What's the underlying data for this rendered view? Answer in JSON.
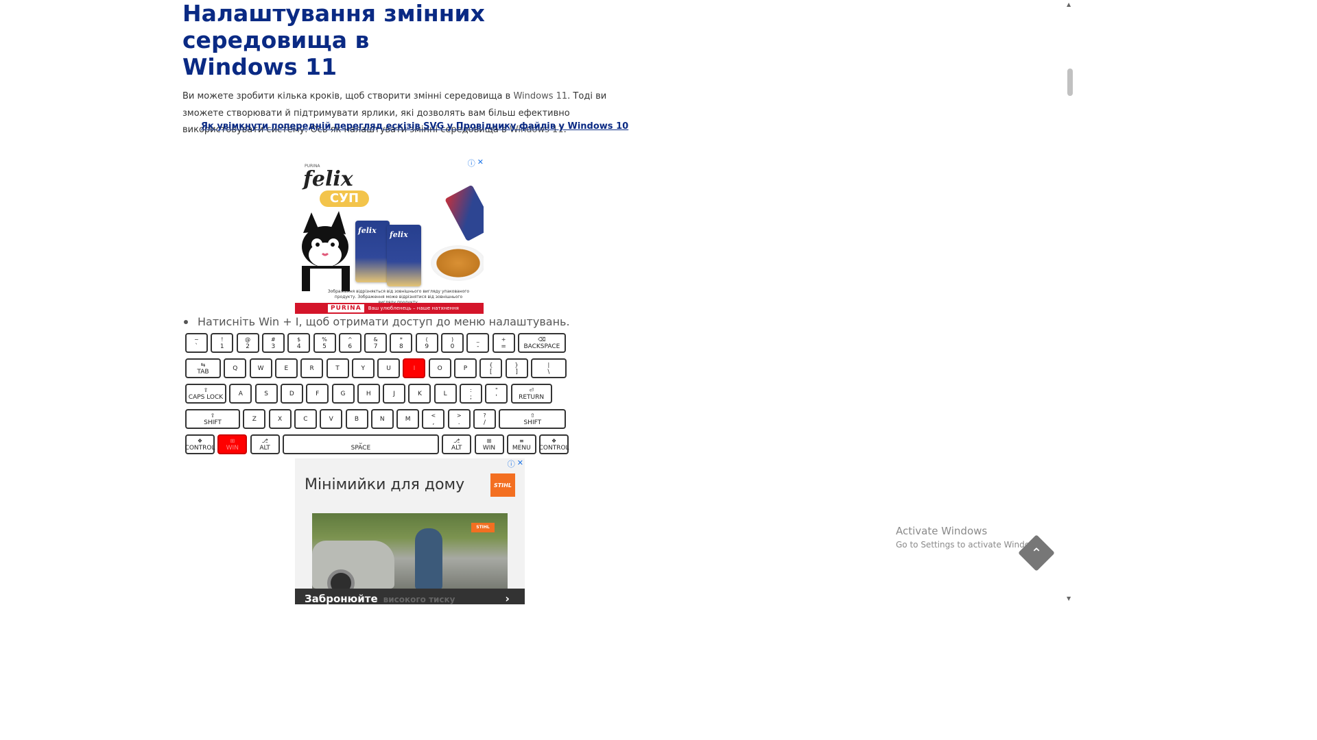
{
  "article": {
    "title_line1": "Налаштування змінних середовища в",
    "title_line2": "Windows 11",
    "intro_part1": "Ви можете зробити кілька кроків, щоб створити змінні середовища в ",
    "intro_win1": "Windows 11",
    "intro_part2": ". Тоді ви зможете створювати й підтримувати ярлики, які дозволять вам більш ефективно використовувати систему. Ось як налаштувати змінні середовища в ",
    "intro_win2": "Windows 11",
    "intro_part3": ".",
    "related_link": "Як увімкнути попередній перегляд ескізів SVG у Провіднику файлів у Windows 10",
    "bullet_text": "Натисніть Win + I, щоб отримати доступ до меню налаштувань."
  },
  "ad1": {
    "choice_icon": "info-icon",
    "brand_top": "PURINA",
    "felix": "felix",
    "soup": "СУП",
    "pack_label1": "felix",
    "pack_label2": "felix",
    "fine_print": "Зображення відрізняється від зовнішнього вигляду упакованого продукту. Зображення може відрізнятися від зовнішнього вигляду продукту.",
    "purina": "PURINA",
    "slogan": "Ваш улюбленець – наше натхнення"
  },
  "keyboard": {
    "rows": [
      [
        [
          "~",
          "`"
        ],
        [
          "!",
          "1"
        ],
        [
          "@",
          "2"
        ],
        [
          "#",
          "3"
        ],
        [
          "$",
          "4"
        ],
        [
          "%",
          "5"
        ],
        [
          "^",
          "6"
        ],
        [
          "&",
          "7"
        ],
        [
          "*",
          "8"
        ],
        [
          "(",
          "9"
        ],
        [
          ")",
          "0"
        ],
        [
          "_",
          "-"
        ],
        [
          "+",
          "="
        ],
        [
          "⌫",
          "BACKSPACE"
        ]
      ],
      [
        [
          "⇆",
          "TAB"
        ],
        [
          "",
          "Q"
        ],
        [
          "",
          "W"
        ],
        [
          "",
          "E"
        ],
        [
          "",
          "R"
        ],
        [
          "",
          "T"
        ],
        [
          "",
          "Y"
        ],
        [
          "",
          "U"
        ],
        [
          "",
          "I"
        ],
        [
          "",
          "O"
        ],
        [
          "",
          "P"
        ],
        [
          "{",
          "["
        ],
        [
          "}",
          "]"
        ],
        [
          "|",
          "\\"
        ]
      ],
      [
        [
          "⇪",
          "CAPS LOCK"
        ],
        [
          "",
          "A"
        ],
        [
          "",
          "S"
        ],
        [
          "",
          "D"
        ],
        [
          "",
          "F"
        ],
        [
          "",
          "G"
        ],
        [
          "",
          "H"
        ],
        [
          "",
          "J"
        ],
        [
          "",
          "K"
        ],
        [
          "",
          "L"
        ],
        [
          ":",
          ";"
        ],
        [
          "\"",
          "'"
        ],
        [
          "⏎",
          "RETURN"
        ]
      ],
      [
        [
          "⇧",
          "SHIFT"
        ],
        [
          "",
          "Z"
        ],
        [
          "",
          "X"
        ],
        [
          "",
          "C"
        ],
        [
          "",
          "V"
        ],
        [
          "",
          "B"
        ],
        [
          "",
          "N"
        ],
        [
          "",
          "M"
        ],
        [
          "<",
          ","
        ],
        [
          ">",
          "."
        ],
        [
          "?",
          "/"
        ],
        [
          "⇧",
          "SHIFT"
        ]
      ],
      [
        [
          "❖",
          "CONTROL"
        ],
        [
          "⊞",
          "WIN"
        ],
        [
          "⎇",
          "ALT"
        ],
        [
          "⎵",
          "SPACE"
        ],
        [
          "⎇",
          "ALT"
        ],
        [
          "⊞",
          "WIN"
        ],
        [
          "≡",
          "MENU"
        ],
        [
          "❖",
          "CONTROL"
        ]
      ]
    ],
    "highlighted": [
      "I",
      "WIN-left"
    ]
  },
  "ad2": {
    "title": "Мінімийки для дому",
    "logo": "STIHL",
    "photo_badge": "STIHL",
    "cta": "Забронюйте",
    "cta_ghost": "високого тиску",
    "arrow": "›"
  },
  "os_watermark": {
    "line1": "Activate Windows",
    "line2": "Go to Settings to activate Windows."
  },
  "back_to_top_icon": "chevron-up-icon",
  "colors": {
    "title": "#0a2a84",
    "highlight_key": "#ff0000",
    "ad1_bar": "#d4152a",
    "stihl": "#f36f21"
  }
}
